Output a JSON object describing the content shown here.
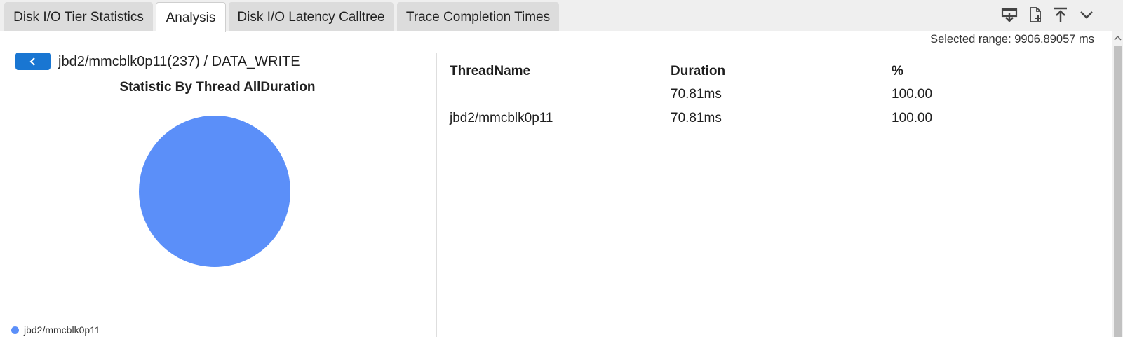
{
  "tabs": [
    {
      "label": "Disk I/O Tier Statistics",
      "active": false
    },
    {
      "label": "Analysis",
      "active": true
    },
    {
      "label": "Disk I/O Latency Calltree",
      "active": false
    },
    {
      "label": "Trace Completion Times",
      "active": false
    }
  ],
  "toolbar_icons": [
    "download-icon",
    "add-file-icon",
    "upload-icon",
    "chevron-down-icon"
  ],
  "selected_range": "Selected range: 9906.89057 ms",
  "breadcrumb": "jbd2/mmcblk0p11(237) / DATA_WRITE",
  "chart_data": {
    "type": "pie",
    "title": "Statistic By Thread AllDuration",
    "slices": [
      {
        "label": "jbd2/mmcblk0p11",
        "value": 100.0,
        "color": "#5b8ff9"
      }
    ],
    "legend": [
      "jbd2/mmcblk0p11"
    ],
    "legend_placement": "bottom-left"
  },
  "table": {
    "headers": [
      "ThreadName",
      "Duration",
      "%"
    ],
    "rows": [
      [
        "",
        "70.81ms",
        "100.00"
      ],
      [
        "jbd2/mmcblk0p11",
        "70.81ms",
        "100.00"
      ]
    ]
  },
  "colors": {
    "accent": "#1976d2",
    "pie_slice": "#5b8ff9",
    "tab_inactive": "#dcdcdc",
    "tabbar_bg": "#efefef"
  }
}
